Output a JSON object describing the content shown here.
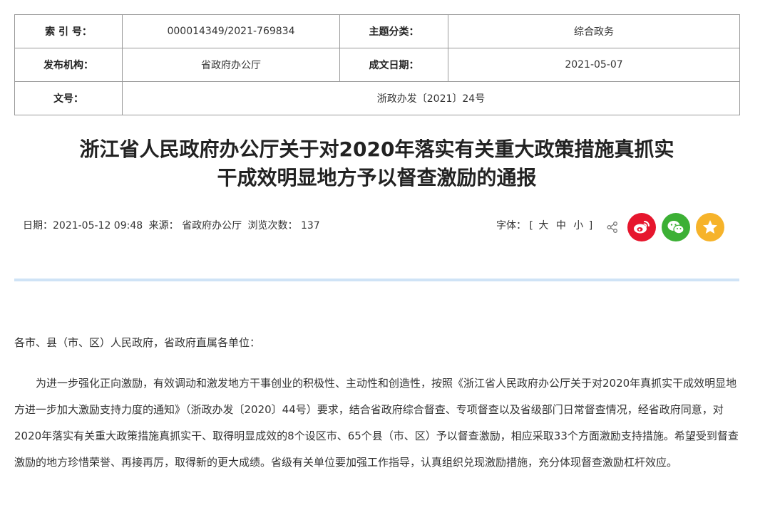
{
  "meta": {
    "index_label": "索 引 号：",
    "index_value": "000014349/2021-769834",
    "category_label": "主题分类：",
    "category_value": "综合政务",
    "issuer_label": "发布机构：",
    "issuer_value": "省政府办公厅",
    "date_label": "成文日期：",
    "date_value": "2021-05-07",
    "docno_label": "文号：",
    "docno_value": "浙政办发〔2021〕24号"
  },
  "title": {
    "line1": "浙江省人民政府办公厅关于对2020年落实有关重大政策措施真抓实",
    "line2": "干成效明显地方予以督查激励的通报"
  },
  "info": {
    "date": "日期：2021-05-12 09:48",
    "source": "来源：  省政府办公厅",
    "views": "浏览次数：  137"
  },
  "font_size": {
    "label": "字体：",
    "open": "[",
    "large": "大",
    "medium": "中",
    "small": "小",
    "close": "]"
  },
  "icons": {
    "share": "share-icon",
    "weibo": "weibo-icon",
    "wechat": "wechat-icon",
    "favorite": "favorite-star-icon"
  },
  "colors": {
    "weibo": "#e6162d",
    "wechat": "#3cb035",
    "favorite": "#f6b32a",
    "divider": "#cfe3f6"
  },
  "content": {
    "salutation": "各市、县（市、区）人民政府，省政府直属各单位：",
    "paragraph1": "为进一步强化正向激励，有效调动和激发地方干事创业的积极性、主动性和创造性，按照《浙江省人民政府办公厅关于对2020年真抓实干成效明显地方进一步加大激励支持力度的通知》（浙政办发〔2020〕44号）要求，结合省政府综合督查、专项督查以及省级部门日常督查情况，经省政府同意，对2020年落实有关重大政策措施真抓实干、取得明显成效的8个设区市、65个县（市、区）予以督查激励，相应采取33个方面激励支持措施。希望受到督查激励的地方珍惜荣誉、再接再厉，取得新的更大成绩。省级有关单位要加强工作指导，认真组织兑现激励措施，充分体现督查激励杠杆效应。"
  }
}
